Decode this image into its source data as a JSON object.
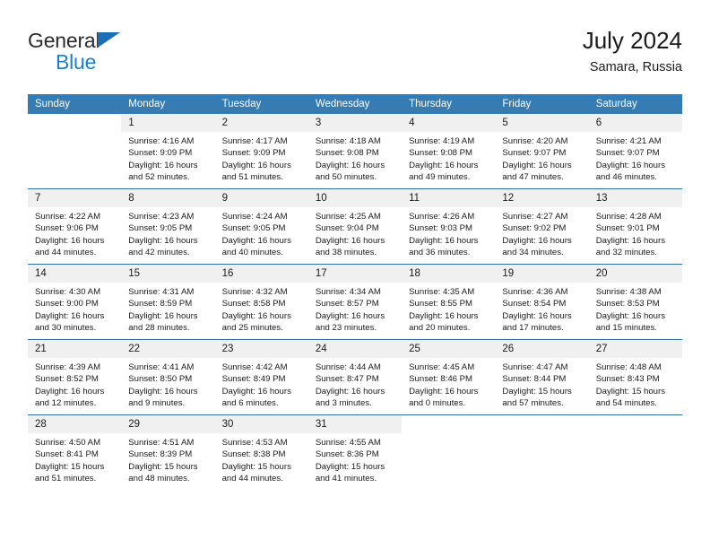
{
  "brand": {
    "name_part1": "General",
    "name_part2": "Blue",
    "triangle_icon": "triangle-icon",
    "accent_color": "#1b7fd4"
  },
  "header": {
    "title": "July 2024",
    "subtitle": "Samara, Russia"
  },
  "colors": {
    "header_row_background": "#357cb4",
    "header_row_text": "#ffffff",
    "daynum_background": "#f0f0f0",
    "row_separator": "#2f6ea5",
    "body_text": "#1a1a1a"
  },
  "calendar": {
    "weekday_headers": [
      "Sunday",
      "Monday",
      "Tuesday",
      "Wednesday",
      "Thursday",
      "Friday",
      "Saturday"
    ],
    "weeks": [
      [
        {
          "day": "",
          "blank": true,
          "sunrise": "",
          "sunset": "",
          "daylight_line1": "",
          "daylight_line2": ""
        },
        {
          "day": "1",
          "sunrise": "Sunrise: 4:16 AM",
          "sunset": "Sunset: 9:09 PM",
          "daylight_line1": "Daylight: 16 hours",
          "daylight_line2": "and 52 minutes."
        },
        {
          "day": "2",
          "sunrise": "Sunrise: 4:17 AM",
          "sunset": "Sunset: 9:09 PM",
          "daylight_line1": "Daylight: 16 hours",
          "daylight_line2": "and 51 minutes."
        },
        {
          "day": "3",
          "sunrise": "Sunrise: 4:18 AM",
          "sunset": "Sunset: 9:08 PM",
          "daylight_line1": "Daylight: 16 hours",
          "daylight_line2": "and 50 minutes."
        },
        {
          "day": "4",
          "sunrise": "Sunrise: 4:19 AM",
          "sunset": "Sunset: 9:08 PM",
          "daylight_line1": "Daylight: 16 hours",
          "daylight_line2": "and 49 minutes."
        },
        {
          "day": "5",
          "sunrise": "Sunrise: 4:20 AM",
          "sunset": "Sunset: 9:07 PM",
          "daylight_line1": "Daylight: 16 hours",
          "daylight_line2": "and 47 minutes."
        },
        {
          "day": "6",
          "sunrise": "Sunrise: 4:21 AM",
          "sunset": "Sunset: 9:07 PM",
          "daylight_line1": "Daylight: 16 hours",
          "daylight_line2": "and 46 minutes."
        }
      ],
      [
        {
          "day": "7",
          "sunrise": "Sunrise: 4:22 AM",
          "sunset": "Sunset: 9:06 PM",
          "daylight_line1": "Daylight: 16 hours",
          "daylight_line2": "and 44 minutes."
        },
        {
          "day": "8",
          "sunrise": "Sunrise: 4:23 AM",
          "sunset": "Sunset: 9:05 PM",
          "daylight_line1": "Daylight: 16 hours",
          "daylight_line2": "and 42 minutes."
        },
        {
          "day": "9",
          "sunrise": "Sunrise: 4:24 AM",
          "sunset": "Sunset: 9:05 PM",
          "daylight_line1": "Daylight: 16 hours",
          "daylight_line2": "and 40 minutes."
        },
        {
          "day": "10",
          "sunrise": "Sunrise: 4:25 AM",
          "sunset": "Sunset: 9:04 PM",
          "daylight_line1": "Daylight: 16 hours",
          "daylight_line2": "and 38 minutes."
        },
        {
          "day": "11",
          "sunrise": "Sunrise: 4:26 AM",
          "sunset": "Sunset: 9:03 PM",
          "daylight_line1": "Daylight: 16 hours",
          "daylight_line2": "and 36 minutes."
        },
        {
          "day": "12",
          "sunrise": "Sunrise: 4:27 AM",
          "sunset": "Sunset: 9:02 PM",
          "daylight_line1": "Daylight: 16 hours",
          "daylight_line2": "and 34 minutes."
        },
        {
          "day": "13",
          "sunrise": "Sunrise: 4:28 AM",
          "sunset": "Sunset: 9:01 PM",
          "daylight_line1": "Daylight: 16 hours",
          "daylight_line2": "and 32 minutes."
        }
      ],
      [
        {
          "day": "14",
          "sunrise": "Sunrise: 4:30 AM",
          "sunset": "Sunset: 9:00 PM",
          "daylight_line1": "Daylight: 16 hours",
          "daylight_line2": "and 30 minutes."
        },
        {
          "day": "15",
          "sunrise": "Sunrise: 4:31 AM",
          "sunset": "Sunset: 8:59 PM",
          "daylight_line1": "Daylight: 16 hours",
          "daylight_line2": "and 28 minutes."
        },
        {
          "day": "16",
          "sunrise": "Sunrise: 4:32 AM",
          "sunset": "Sunset: 8:58 PM",
          "daylight_line1": "Daylight: 16 hours",
          "daylight_line2": "and 25 minutes."
        },
        {
          "day": "17",
          "sunrise": "Sunrise: 4:34 AM",
          "sunset": "Sunset: 8:57 PM",
          "daylight_line1": "Daylight: 16 hours",
          "daylight_line2": "and 23 minutes."
        },
        {
          "day": "18",
          "sunrise": "Sunrise: 4:35 AM",
          "sunset": "Sunset: 8:55 PM",
          "daylight_line1": "Daylight: 16 hours",
          "daylight_line2": "and 20 minutes."
        },
        {
          "day": "19",
          "sunrise": "Sunrise: 4:36 AM",
          "sunset": "Sunset: 8:54 PM",
          "daylight_line1": "Daylight: 16 hours",
          "daylight_line2": "and 17 minutes."
        },
        {
          "day": "20",
          "sunrise": "Sunrise: 4:38 AM",
          "sunset": "Sunset: 8:53 PM",
          "daylight_line1": "Daylight: 16 hours",
          "daylight_line2": "and 15 minutes."
        }
      ],
      [
        {
          "day": "21",
          "sunrise": "Sunrise: 4:39 AM",
          "sunset": "Sunset: 8:52 PM",
          "daylight_line1": "Daylight: 16 hours",
          "daylight_line2": "and 12 minutes."
        },
        {
          "day": "22",
          "sunrise": "Sunrise: 4:41 AM",
          "sunset": "Sunset: 8:50 PM",
          "daylight_line1": "Daylight: 16 hours",
          "daylight_line2": "and 9 minutes."
        },
        {
          "day": "23",
          "sunrise": "Sunrise: 4:42 AM",
          "sunset": "Sunset: 8:49 PM",
          "daylight_line1": "Daylight: 16 hours",
          "daylight_line2": "and 6 minutes."
        },
        {
          "day": "24",
          "sunrise": "Sunrise: 4:44 AM",
          "sunset": "Sunset: 8:47 PM",
          "daylight_line1": "Daylight: 16 hours",
          "daylight_line2": "and 3 minutes."
        },
        {
          "day": "25",
          "sunrise": "Sunrise: 4:45 AM",
          "sunset": "Sunset: 8:46 PM",
          "daylight_line1": "Daylight: 16 hours",
          "daylight_line2": "and 0 minutes."
        },
        {
          "day": "26",
          "sunrise": "Sunrise: 4:47 AM",
          "sunset": "Sunset: 8:44 PM",
          "daylight_line1": "Daylight: 15 hours",
          "daylight_line2": "and 57 minutes."
        },
        {
          "day": "27",
          "sunrise": "Sunrise: 4:48 AM",
          "sunset": "Sunset: 8:43 PM",
          "daylight_line1": "Daylight: 15 hours",
          "daylight_line2": "and 54 minutes."
        }
      ],
      [
        {
          "day": "28",
          "sunrise": "Sunrise: 4:50 AM",
          "sunset": "Sunset: 8:41 PM",
          "daylight_line1": "Daylight: 15 hours",
          "daylight_line2": "and 51 minutes."
        },
        {
          "day": "29",
          "sunrise": "Sunrise: 4:51 AM",
          "sunset": "Sunset: 8:39 PM",
          "daylight_line1": "Daylight: 15 hours",
          "daylight_line2": "and 48 minutes."
        },
        {
          "day": "30",
          "sunrise": "Sunrise: 4:53 AM",
          "sunset": "Sunset: 8:38 PM",
          "daylight_line1": "Daylight: 15 hours",
          "daylight_line2": "and 44 minutes."
        },
        {
          "day": "31",
          "sunrise": "Sunrise: 4:55 AM",
          "sunset": "Sunset: 8:36 PM",
          "daylight_line1": "Daylight: 15 hours",
          "daylight_line2": "and 41 minutes."
        },
        {
          "day": "",
          "blank": true,
          "sunrise": "",
          "sunset": "",
          "daylight_line1": "",
          "daylight_line2": ""
        },
        {
          "day": "",
          "blank": true,
          "sunrise": "",
          "sunset": "",
          "daylight_line1": "",
          "daylight_line2": ""
        },
        {
          "day": "",
          "blank": true,
          "sunrise": "",
          "sunset": "",
          "daylight_line1": "",
          "daylight_line2": ""
        }
      ]
    ]
  }
}
